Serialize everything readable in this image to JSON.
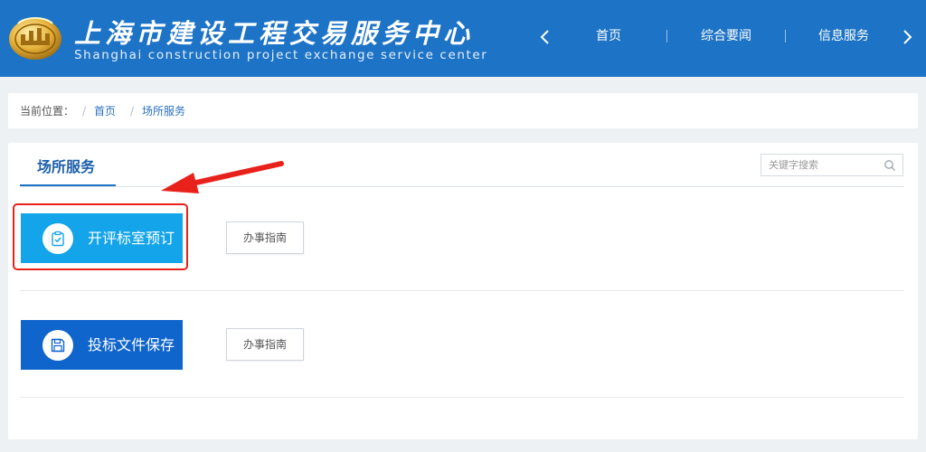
{
  "header": {
    "title": "上海市建设工程交易服务中心",
    "subtitle": "Shanghai construction project exchange service center",
    "nav": [
      {
        "label": "首页"
      },
      {
        "label": "综合要闻"
      },
      {
        "label": "信息服务"
      }
    ]
  },
  "breadcrumb": {
    "label": "当前位置：",
    "separator": "/",
    "items": [
      {
        "label": "首页"
      },
      {
        "label": "场所服务"
      }
    ]
  },
  "main": {
    "tab_label": "场所服务",
    "search": {
      "placeholder": "关键字搜索"
    },
    "services": [
      {
        "label": "开评标室预订",
        "guide_label": "办事指南",
        "icon": "clipboard-check-icon",
        "color": "#14a4ea"
      },
      {
        "label": "投标文件保存",
        "guide_label": "办事指南",
        "icon": "floppy-disk-icon",
        "color": "#0f65cc"
      }
    ]
  },
  "colors": {
    "header_bg": "#1d73c6",
    "link": "#2a6fc0",
    "annotation": "#e8221b"
  }
}
